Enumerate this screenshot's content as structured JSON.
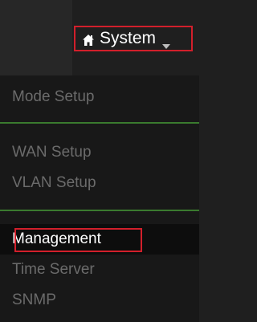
{
  "header": {
    "system_label": "System"
  },
  "menu": {
    "items": [
      {
        "label": "Mode Setup"
      },
      {
        "label": "WAN Setup"
      },
      {
        "label": "VLAN Setup"
      },
      {
        "label": "Management"
      },
      {
        "label": "Time Server"
      },
      {
        "label": "SNMP"
      }
    ]
  },
  "colors": {
    "highlight_border": "#d21f2b",
    "divider": "#3a7a2e",
    "inactive_text": "#6b6b6b",
    "active_text": "#ffffff"
  },
  "icons": [
    "home-icon",
    "caret-down-icon"
  ]
}
